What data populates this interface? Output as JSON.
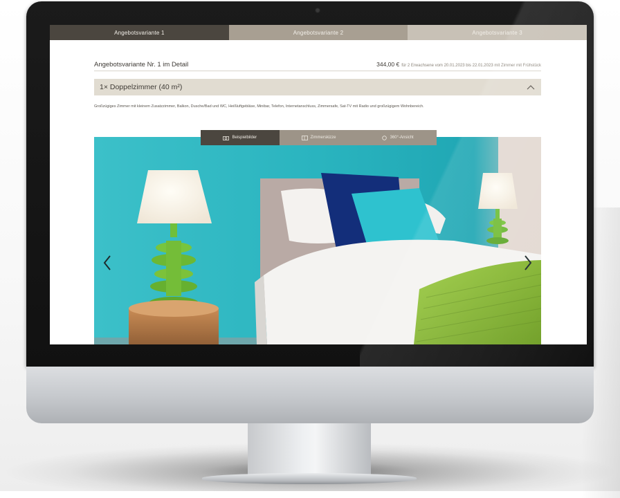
{
  "tabs": [
    {
      "label": "Angebotsvariante 1",
      "active": true
    },
    {
      "label": "Angebotsvariante 2",
      "active": false
    },
    {
      "label": "Angebotsvariante 3",
      "active": false
    }
  ],
  "header": {
    "title": "Angebotsvariante Nr. 1 im Detail",
    "price": "344,00 €",
    "price_note": "für 2 Erwachsene vom 20.01.2023 bis 22.01.2023 mit Zimmer mit Frühstück"
  },
  "room": {
    "title": "1× Doppelzimmer (40 m²)",
    "description": "Großzügiges Zimmer mit kleinem Zusatzzimmer, Balkon, Dusche/Bad und WC, Heißluftgebläse, Minibar, Telefon, Internetanschluss, Zimmersafe, Sat-TV mit Radio und großzügigem Wohnbereich."
  },
  "gallery": {
    "tabs": [
      {
        "label": "Beispielbilder",
        "icon": "camera-icon",
        "active": true
      },
      {
        "label": "Zimmerskizze",
        "icon": "floorplan-icon",
        "active": false
      },
      {
        "label": "360°-Ansicht",
        "icon": "rotate-360-icon",
        "active": false
      }
    ]
  },
  "colors": {
    "active_tab": "#4b463f",
    "room_bar": "#e1dcd1",
    "wall_turquoise": "#2fb8c2",
    "lamp_green": "#7cc23a"
  }
}
